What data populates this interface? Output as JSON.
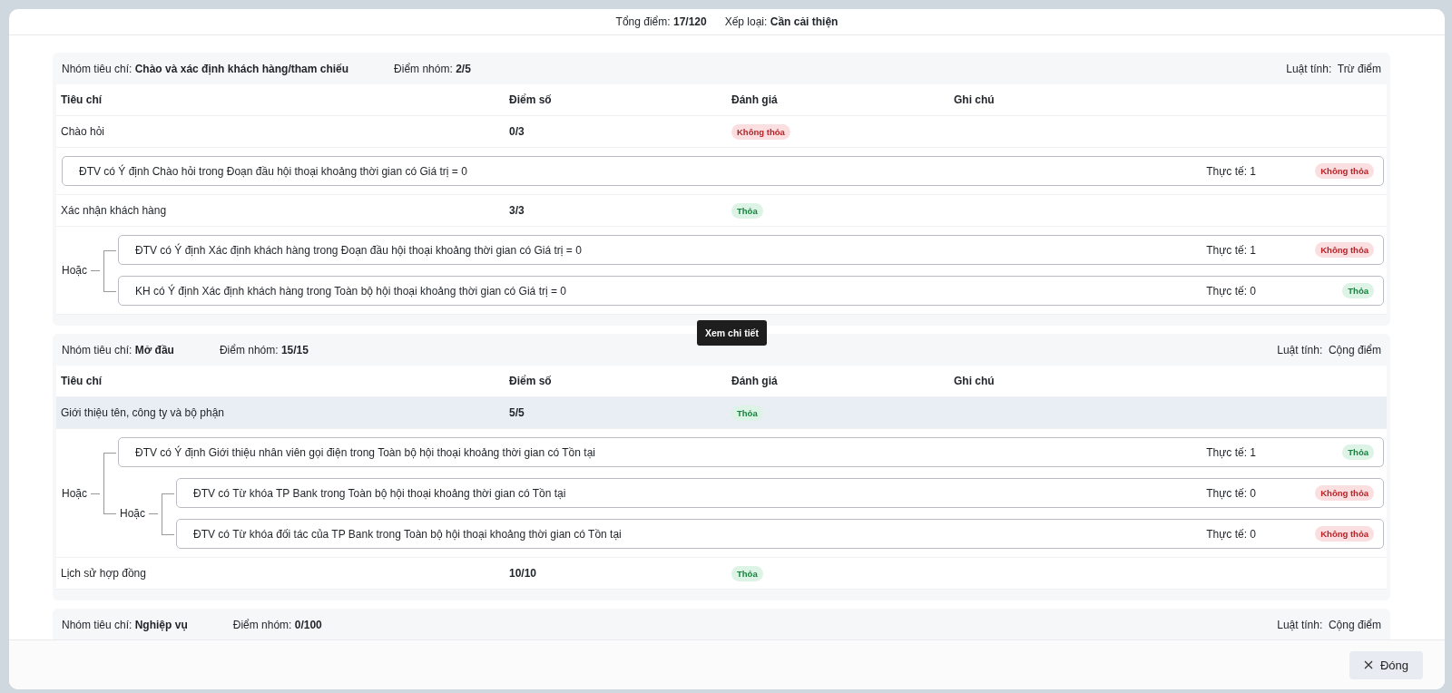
{
  "summary": {
    "total_label": "Tổng điểm:",
    "total": "17/120",
    "rank_label": "Xếp loại:",
    "rank": "Cần cải thiện"
  },
  "groups": [
    {
      "name_label": "Nhóm tiêu chí:",
      "name": "Chào và xác định khách hàng/tham chiếu",
      "score_label": "Điểm nhóm:",
      "score": "2/5",
      "rule_label": "Luật tính:",
      "rule": "Trừ điểm",
      "columns": [
        "Tiêu chí",
        "Điểm số",
        "Đánh giá",
        "Ghi chú"
      ],
      "rows": [
        {
          "name": "Chào hỏi",
          "score": "0/3",
          "result": "Không thỏa",
          "satisfied": false,
          "highlighted": false,
          "condition": {
            "kind": "leaf",
            "text": "ĐTV có Ý định Chào hỏi trong Đoạn đầu hội thoại khoảng thời gian có Giá trị = 0",
            "actual": "Thực tế: 1",
            "result": "Không thỏa",
            "satisfied": false
          }
        },
        {
          "name": "Xác nhận khách hàng",
          "score": "3/3",
          "result": "Thỏa",
          "satisfied": true,
          "highlighted": false,
          "condition": {
            "kind": "operator",
            "operator": "Hoặc",
            "children": [
              {
                "kind": "leaf",
                "text": "ĐTV có Ý định Xác định khách hàng trong Đoạn đầu hội thoại khoảng thời gian có Giá trị = 0",
                "actual": "Thực tế: 1",
                "result": "Không thỏa",
                "satisfied": false
              },
              {
                "kind": "leaf",
                "text": "KH có Ý định Xác định khách hàng trong Toàn bộ hội thoại khoảng thời gian có Giá trị = 0",
                "actual": "Thực tế: 0",
                "result": "Thỏa",
                "satisfied": true
              }
            ]
          }
        }
      ]
    },
    {
      "name_label": "Nhóm tiêu chí:",
      "name": "Mở đầu",
      "score_label": "Điểm nhóm:",
      "score": "15/15",
      "rule_label": "Luật tính:",
      "rule": "Cộng điểm",
      "columns": [
        "Tiêu chí",
        "Điểm số",
        "Đánh giá",
        "Ghi chú"
      ],
      "rows": [
        {
          "name": "Giới thiệu tên, công ty và bộ phận",
          "score": "5/5",
          "result": "Thỏa",
          "satisfied": true,
          "highlighted": true,
          "tooltip": "Xem chi tiết",
          "condition": {
            "kind": "operator",
            "operator": "Hoặc",
            "children": [
              {
                "kind": "leaf",
                "text": "ĐTV có Ý định Giới thiệu nhân viên gọi điện trong Toàn bộ hội thoại khoảng thời gian có Tồn tại",
                "actual": "Thực tế: 1",
                "result": "Thỏa",
                "satisfied": true
              },
              {
                "kind": "operator",
                "operator": "Hoặc",
                "children": [
                  {
                    "kind": "leaf",
                    "text": "ĐTV có Từ khóa TP Bank trong Toàn bộ hội thoại khoảng thời gian có Tồn tại",
                    "actual": "Thực tế: 0",
                    "result": "Không thỏa",
                    "satisfied": false
                  },
                  {
                    "kind": "leaf",
                    "text": "ĐTV có Từ khóa đối tác của TP Bank trong Toàn bộ hội thoại khoảng thời gian có Tồn tại",
                    "actual": "Thực tế: 0",
                    "result": "Không thỏa",
                    "satisfied": false
                  }
                ]
              }
            ]
          }
        },
        {
          "name": "Lịch sử hợp đồng",
          "score": "10/10",
          "result": "Thỏa",
          "satisfied": true,
          "highlighted": false
        }
      ]
    },
    {
      "name_label": "Nhóm tiêu chí:",
      "name": "Nghiệp vụ",
      "score_label": "Điểm nhóm:",
      "score": "0/100",
      "rule_label": "Luật tính:",
      "rule": "Cộng điểm"
    }
  ],
  "footer": {
    "close_button": "Đóng"
  }
}
